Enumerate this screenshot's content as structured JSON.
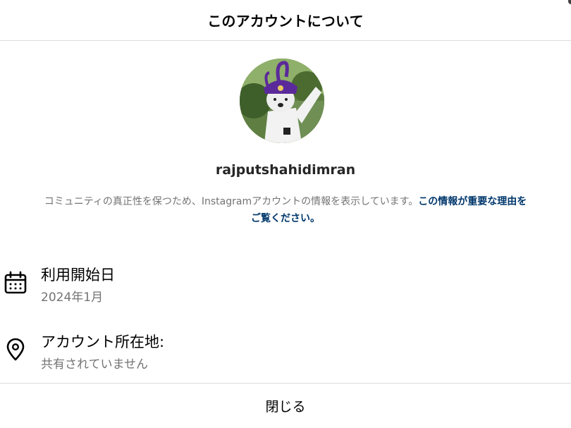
{
  "dialog": {
    "title": "このアカウントについて",
    "close_label": "閉じる"
  },
  "profile": {
    "username": "rajputshahidimran",
    "avatar_icon": "profile-avatar"
  },
  "description": {
    "text": "コミュニティの真正性を保つため、Instagramアカウントの情報を表示しています。",
    "link_text_line1": "この情報が重要な理由を",
    "link_text_line2": "ご覧ください。"
  },
  "details": {
    "joined": {
      "icon": "calendar-icon",
      "label": "利用開始日",
      "value": "2024年1月"
    },
    "location": {
      "icon": "location-pin-icon",
      "label": "アカウント所在地:",
      "value": "共有されていません"
    }
  },
  "colors": {
    "link": "#00376b",
    "secondary_text": "#737373",
    "divider": "#dbdbdb"
  }
}
